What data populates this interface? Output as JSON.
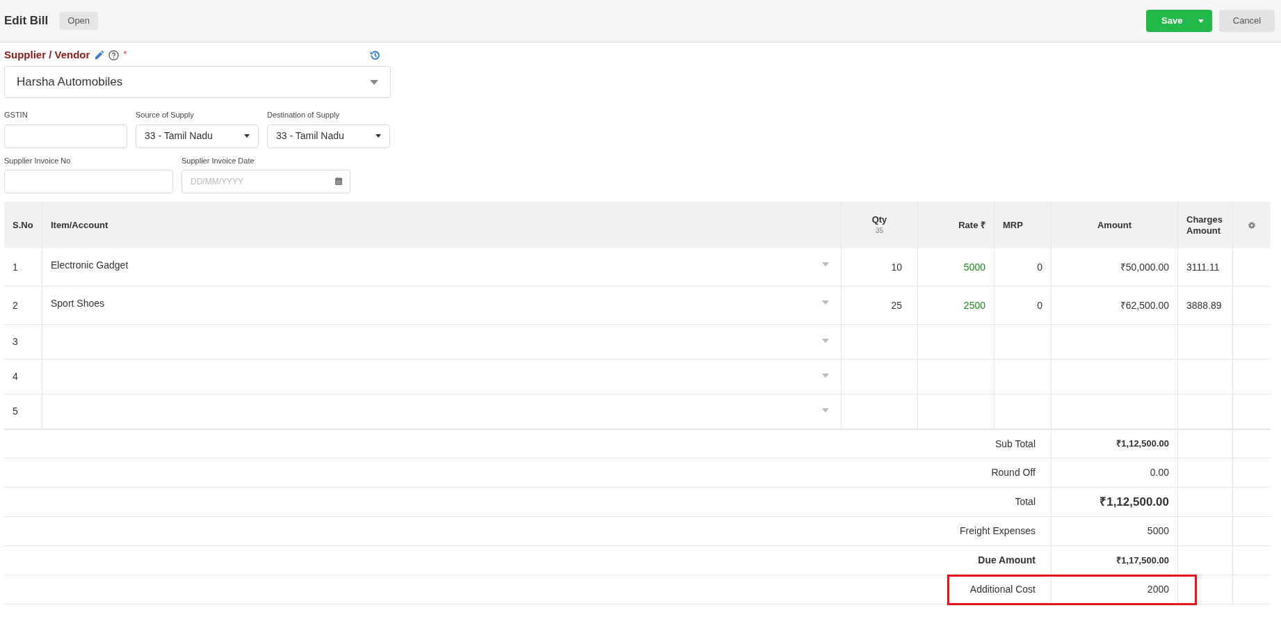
{
  "header": {
    "title": "Edit Bill",
    "status": "Open",
    "save": "Save",
    "cancel": "Cancel"
  },
  "supplier": {
    "label": "Supplier / Vendor",
    "required": "*",
    "value": "Harsha Automobiles"
  },
  "field_rows": [
    [
      {
        "kind": "text",
        "label": "GSTIN"
      },
      {
        "kind": "select",
        "label": "Source of Supply",
        "value": "33 - Tamil Nadu"
      },
      {
        "kind": "select",
        "label": "Destination of Supply",
        "value": "33 - Tamil Nadu"
      }
    ],
    [
      {
        "kind": "text",
        "label": "Supplier Invoice No"
      },
      {
        "kind": "date",
        "label": "Supplier Invoice Date",
        "placeholder": "DD/MM/YYYY"
      }
    ]
  ],
  "table": {
    "columns": [
      {
        "label": "S.No"
      },
      {
        "label": "Item/Account"
      },
      {
        "label": "Qty",
        "sublabel": "35"
      },
      {
        "label": "Rate ₹"
      },
      {
        "label": "MRP"
      },
      {
        "label": "Amount"
      },
      {
        "label": "Charges Amount"
      }
    ],
    "rows": [
      {
        "sno": "1",
        "item": "Electronic Gadget",
        "qty": "10",
        "rate": "5000",
        "mrp": "0",
        "amount": "₹50,000.00",
        "charges": "3111.11"
      },
      {
        "sno": "2",
        "item": "Sport Shoes",
        "qty": "25",
        "rate": "2500",
        "mrp": "0",
        "amount": "₹62,500.00",
        "charges": "3888.89"
      },
      {
        "sno": "3"
      },
      {
        "sno": "4"
      },
      {
        "sno": "5"
      }
    ],
    "totals": [
      {
        "kind": "subtotal",
        "label": "Sub Total",
        "value": "₹1,12,500.00",
        "highlighted": false
      },
      {
        "kind": "plain",
        "label": "Round Off",
        "value": "0.00",
        "highlighted": false
      },
      {
        "kind": "total",
        "label": "Total",
        "value": "₹1,12,500.00",
        "highlighted": false
      },
      {
        "kind": "plain",
        "label": "Freight Expenses",
        "value": "5000",
        "highlighted": false
      },
      {
        "kind": "due",
        "label": "Due Amount",
        "value": "₹1,17,500.00",
        "highlighted": false
      },
      {
        "kind": "plain",
        "label": "Additional Cost",
        "value": "2000",
        "highlighted": true
      }
    ]
  }
}
